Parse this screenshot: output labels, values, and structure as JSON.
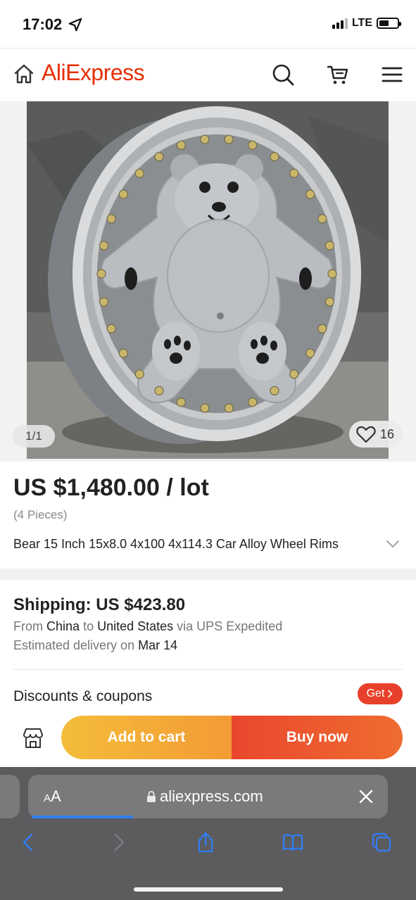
{
  "status_bar": {
    "time": "17:02",
    "network": "LTE",
    "signal_bars": 3,
    "battery_level": 0.55
  },
  "header": {
    "brand": "AliExpress",
    "icons": [
      "home-icon",
      "search-icon",
      "cart-icon",
      "menu-icon"
    ]
  },
  "product": {
    "image_counter": "1/1",
    "wishlist_count": "16",
    "price": "US $1,480.00 / lot",
    "pieces": "(4 Pieces)",
    "title": "Bear 15 Inch 15x8.0 4x100 4x114.3 Car Alloy Wheel Rims"
  },
  "shipping": {
    "title": "Shipping: US $423.80",
    "from_label": "From",
    "from": "China",
    "to_label": "to",
    "to": "United States",
    "via_label": "via UPS Expedited",
    "estimate_label": "Estimated delivery on",
    "estimate_date": "Mar 14",
    "discounts_label": "Discounts & coupons",
    "get_button": "Get"
  },
  "actions": {
    "add_to_cart": "Add to cart",
    "buy_now": "Buy now"
  },
  "browser": {
    "text_size_small": "A",
    "text_size_large": "A",
    "url": "aliexpress.com",
    "page_load_progress": 0.3
  },
  "colors": {
    "brand": "#e62e04",
    "cart_button": "#f3ad38",
    "buy_button": "#eb5a2f",
    "safari_bar": "#5c5c5f",
    "link_blue": "#2f7ef6"
  }
}
